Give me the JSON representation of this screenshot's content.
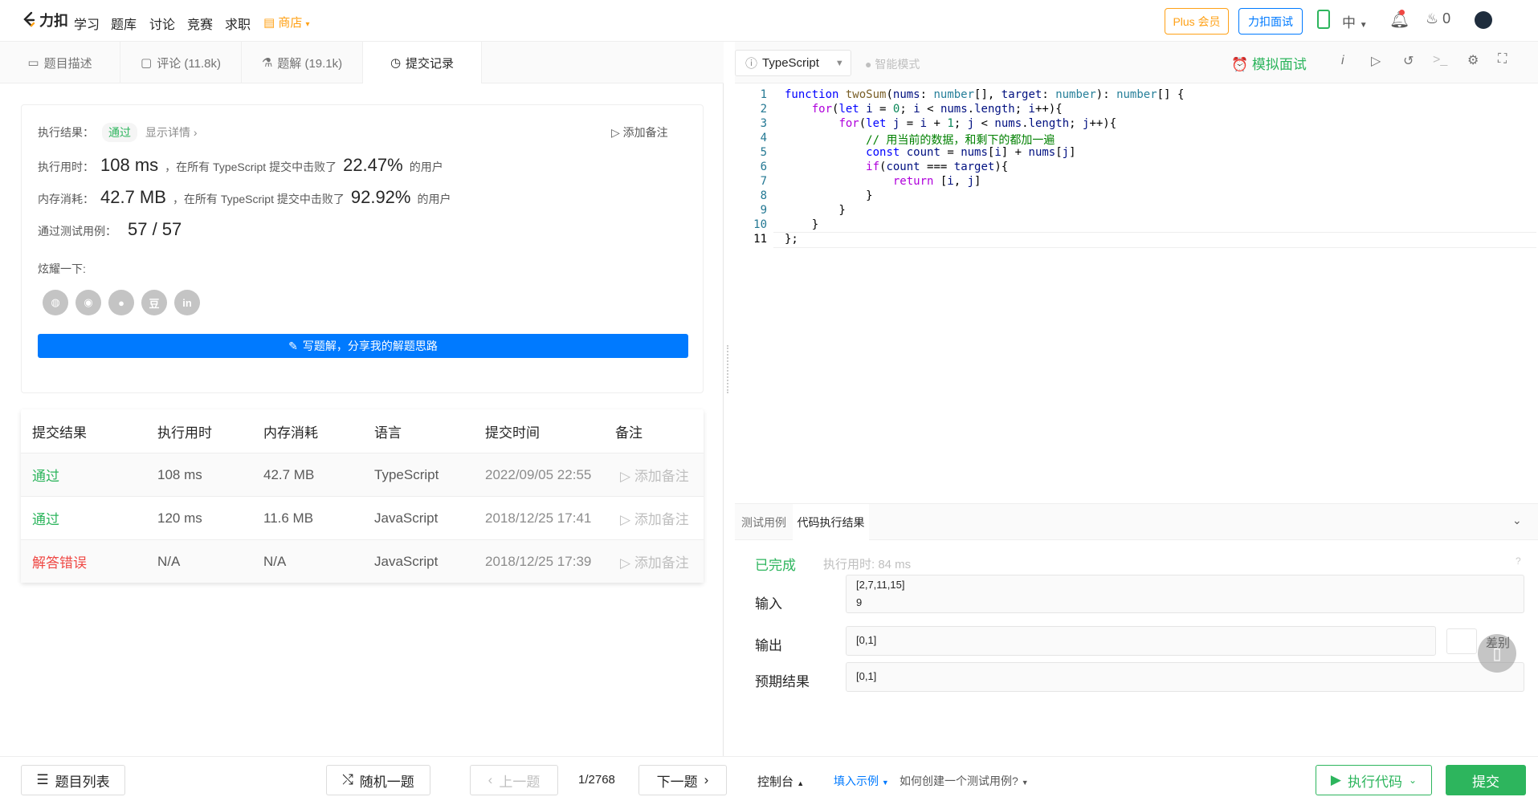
{
  "nav": {
    "logo": "力扣",
    "items": [
      "学习",
      "题库",
      "讨论",
      "竞赛",
      "求职"
    ],
    "shop": "商店",
    "plus": "Plus 会员",
    "interview": "力扣面试",
    "lang": "中",
    "streak": "0"
  },
  "left": {
    "tabs": [
      "题目描述",
      "评论 (11.8k)",
      "题解 (19.1k)",
      "提交记录"
    ],
    "result": {
      "label": "执行结果：",
      "status": "通过",
      "detail": "显示详情",
      "note": "添加备注",
      "time_label": "执行用时：",
      "time": "108 ms",
      "time_text": "，在所有 TypeScript 提交中击败了",
      "time_pct": "22.47%",
      "users": "的用户",
      "mem_label": "内存消耗：",
      "mem": "42.7 MB",
      "mem_text": "，在所有 TypeScript 提交中击败了",
      "mem_pct": "92.92%",
      "cases_label": "通过测试用例：",
      "cases": "57 / 57",
      "share_label": "炫耀一下:",
      "write_btn": "写题解，分享我的解题思路"
    },
    "table": {
      "headers": [
        "提交结果",
        "执行用时",
        "内存消耗",
        "语言",
        "提交时间",
        "备注"
      ],
      "rows": [
        {
          "status": "通过",
          "time": "108 ms",
          "mem": "42.7 MB",
          "lang": "TypeScript",
          "date": "2022/09/05 22:55",
          "note": "添加备注"
        },
        {
          "status": "通过",
          "time": "120 ms",
          "mem": "11.6 MB",
          "lang": "JavaScript",
          "date": "2018/12/25 17:41",
          "note": "添加备注"
        },
        {
          "status": "解答错误",
          "time": "N/A",
          "mem": "N/A",
          "lang": "JavaScript",
          "date": "2018/12/25 17:39",
          "note": "添加备注"
        }
      ]
    }
  },
  "editor": {
    "language": "TypeScript",
    "smart_mode": "智能模式",
    "mock": "模拟面试",
    "line_numbers": [
      "1",
      "2",
      "3",
      "4",
      "5",
      "6",
      "7",
      "8",
      "9",
      "10",
      "11"
    ]
  },
  "console": {
    "tabs": [
      "测试用例",
      "代码执行结果"
    ],
    "done": "已完成",
    "exec_time": "执行用时: 84 ms",
    "input_label": "输入",
    "input_l1": "[2,7,11,15]",
    "input_l2": "9",
    "output_label": "输出",
    "output": "[0,1]",
    "diff": "差别",
    "expected_label": "预期结果",
    "expected": "[0,1]"
  },
  "bottom": {
    "list": "题目列表",
    "random": "随机一题",
    "prev": "上一题",
    "page": "1/2768",
    "next": "下一题",
    "console": "控制台",
    "fill": "填入示例",
    "howto": "如何创建一个测试用例?",
    "run": "执行代码",
    "submit": "提交"
  }
}
